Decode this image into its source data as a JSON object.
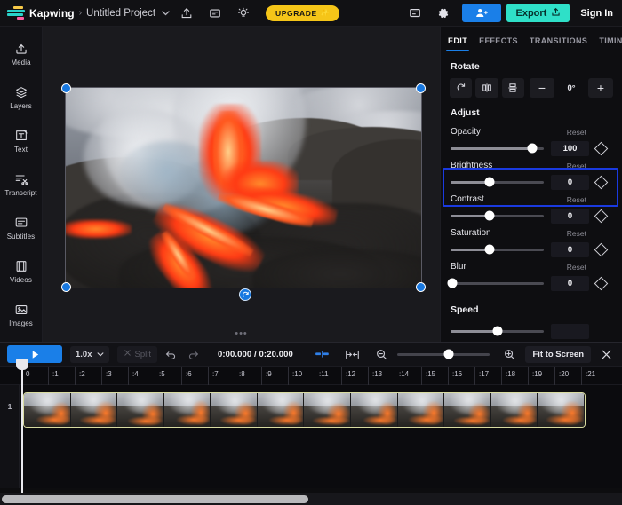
{
  "topbar": {
    "brand": "Kapwing",
    "breadcrumb_separator": "›",
    "project_name": "Untitled Project",
    "project_chevron_icon": "chevron-down-icon",
    "share_icon": "upload-share-icon",
    "comment_icon": "comment-box-icon",
    "ideas_icon": "lightbulb-icon",
    "upgrade_label": "UPGRADE",
    "upgrade_spark": "✨",
    "upgrade_color": "#f5c518",
    "collab_icon": "add-collaborator-icon",
    "collab_color": "#1a7fe8",
    "export_label": "Export",
    "export_icon": "export-upload-icon",
    "export_color": "#2fe0c8",
    "signin_label": "Sign In",
    "settings_icon": "gear-icon"
  },
  "rail": {
    "items": [
      {
        "label": "Media",
        "icon": "upload-media-icon"
      },
      {
        "label": "Layers",
        "icon": "layers-stack-icon"
      },
      {
        "label": "Text",
        "icon": "text-edit-icon"
      },
      {
        "label": "Transcript",
        "icon": "transcript-scissors-icon"
      },
      {
        "label": "Subtitles",
        "icon": "subtitles-box-icon"
      },
      {
        "label": "Videos",
        "icon": "video-film-icon"
      },
      {
        "label": "Images",
        "icon": "image-picture-icon"
      }
    ]
  },
  "stage": {
    "selection_handle_color": "#1878e0",
    "rotate_handle_icon": "rotate-handle-icon",
    "overflow_dots": "•••"
  },
  "right_panel": {
    "tabs": [
      {
        "label": "EDIT",
        "active": true
      },
      {
        "label": "EFFECTS",
        "active": false
      },
      {
        "label": "TRANSITIONS",
        "active": false
      },
      {
        "label": "TIMING",
        "active": false
      }
    ],
    "active_tab_color": "#1a7fe8",
    "rotate": {
      "title": "Rotate",
      "buttons": [
        {
          "icon": "rotate-ccw-icon"
        },
        {
          "icon": "flip-horizontal-icon"
        },
        {
          "icon": "flip-vertical-icon"
        }
      ],
      "decrease_label": "−",
      "degrees_value": "0°",
      "increase_label": "+"
    },
    "adjust": {
      "title": "Adjust",
      "reset_label": "Reset",
      "keyframe_icon": "keyframe-diamond-icon",
      "sliders": [
        {
          "label": "Opacity",
          "value": "100",
          "knob_pct": 88,
          "highlighted": false
        },
        {
          "label": "Brightness",
          "value": "0",
          "knob_pct": 42,
          "highlighted": true
        },
        {
          "label": "Contrast",
          "value": "0",
          "knob_pct": 42,
          "highlighted": false
        },
        {
          "label": "Saturation",
          "value": "0",
          "knob_pct": 42,
          "highlighted": false
        },
        {
          "label": "Blur",
          "value": "0",
          "knob_pct": 2,
          "highlighted": false
        }
      ],
      "highlight_color": "#1a3ae0"
    },
    "speed": {
      "title": "Speed"
    }
  },
  "timeline": {
    "play_icon": "play-triangle-icon",
    "play_color": "#1a7fe8",
    "speed_value": "1.0x",
    "speed_chevron_icon": "chevron-down-icon",
    "split_label": "Split",
    "split_icon": "split-scissors-icon",
    "undo_icon": "undo-arrow-icon",
    "redo_icon": "redo-arrow-icon",
    "current_time": "0:00.000",
    "time_separator": "/",
    "total_time": "0:20.000",
    "marker_icon": "marker-toggle-icon",
    "fit_range_icon": "fit-range-icon",
    "zoom_out_icon": "zoom-out-magnifier-icon",
    "zoom_in_icon": "zoom-in-magnifier-icon",
    "zoom_knob_pct": 55,
    "fit_label": "Fit to Screen",
    "close_icon": "close-x-icon",
    "ruler_labels": [
      "0",
      ":1",
      ":2",
      ":3",
      ":4",
      ":5",
      ":6",
      ":7",
      ":8",
      ":9",
      ":10",
      ":11",
      ":12",
      ":13",
      ":14",
      ":15",
      ":16",
      ":17",
      ":18",
      ":19",
      ":20",
      ":21"
    ],
    "track_number": "1",
    "clip_border_color": "#d8dba0",
    "playhead_position_label": "0"
  }
}
